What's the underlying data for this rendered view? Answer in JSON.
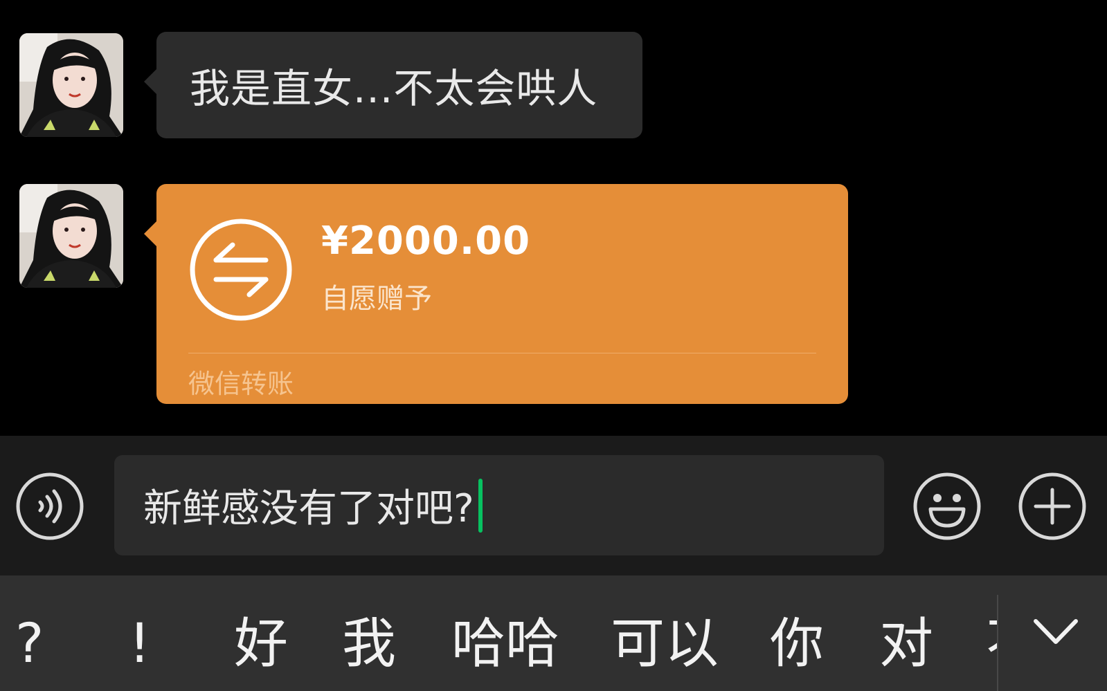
{
  "chat": {
    "messages": [
      {
        "type": "text",
        "text": "我是直女...不太会哄人"
      },
      {
        "type": "transfer",
        "amount": "¥2000.00",
        "note": "自愿赠予",
        "footer": "微信转账"
      }
    ]
  },
  "input": {
    "value": "新鲜感没有了对吧?"
  },
  "suggestions": [
    "?",
    "!",
    "好",
    "我",
    "哈哈",
    "可以",
    "你",
    "对",
    "不"
  ],
  "icons": {
    "voice": "voice-icon",
    "emoji": "emoji-icon",
    "plus": "plus-icon",
    "transfer": "transfer-arrows-icon",
    "collapse": "chevron-down-icon"
  },
  "colors": {
    "background": "#000000",
    "bubble": "#2c2c2c",
    "transfer": "#e58e38",
    "caret": "#07c160",
    "input_bar": "#1b1b1b",
    "suggest_bar": "#303030"
  }
}
